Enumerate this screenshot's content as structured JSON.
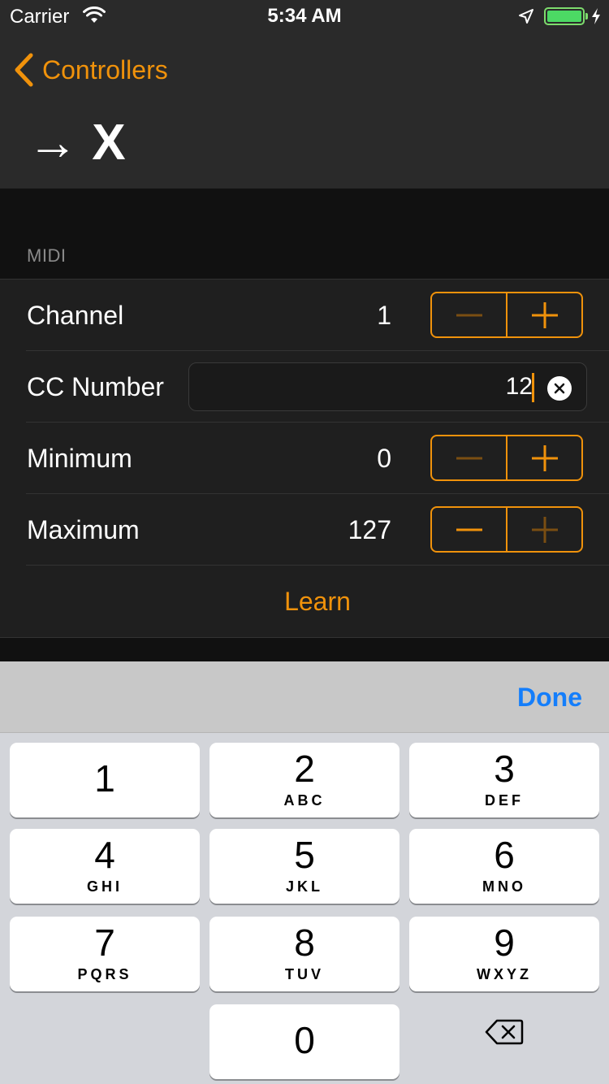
{
  "status_bar": {
    "carrier": "Carrier",
    "time": "5:34 AM",
    "icons": [
      "wifi-icon",
      "location-arrow-icon",
      "battery-icon",
      "charging-bolt-icon"
    ]
  },
  "nav": {
    "back_label": "Controllers",
    "title": "→ X"
  },
  "section": {
    "header": "MIDI"
  },
  "rows": {
    "channel": {
      "label": "Channel",
      "value": "1"
    },
    "cc_number": {
      "label": "CC Number",
      "value": "12"
    },
    "minimum": {
      "label": "Minimum",
      "value": "0"
    },
    "maximum": {
      "label": "Maximum",
      "value": "127"
    }
  },
  "learn_label": "Learn",
  "keyboard": {
    "done_label": "Done",
    "keys": [
      {
        "num": "1",
        "letters": ""
      },
      {
        "num": "2",
        "letters": "ABC"
      },
      {
        "num": "3",
        "letters": "DEF"
      },
      {
        "num": "4",
        "letters": "GHI"
      },
      {
        "num": "5",
        "letters": "JKL"
      },
      {
        "num": "6",
        "letters": "MNO"
      },
      {
        "num": "7",
        "letters": "PQRS"
      },
      {
        "num": "8",
        "letters": "TUV"
      },
      {
        "num": "9",
        "letters": "WXYZ"
      },
      {
        "num": "0",
        "letters": ""
      }
    ]
  },
  "colors": {
    "accent": "#f0920b",
    "accent_dim": "#7a4e12",
    "link_blue": "#147efb",
    "nav_bg": "#2a2a2a",
    "cell_bg": "#1f1f1f",
    "page_bg": "#111111"
  }
}
